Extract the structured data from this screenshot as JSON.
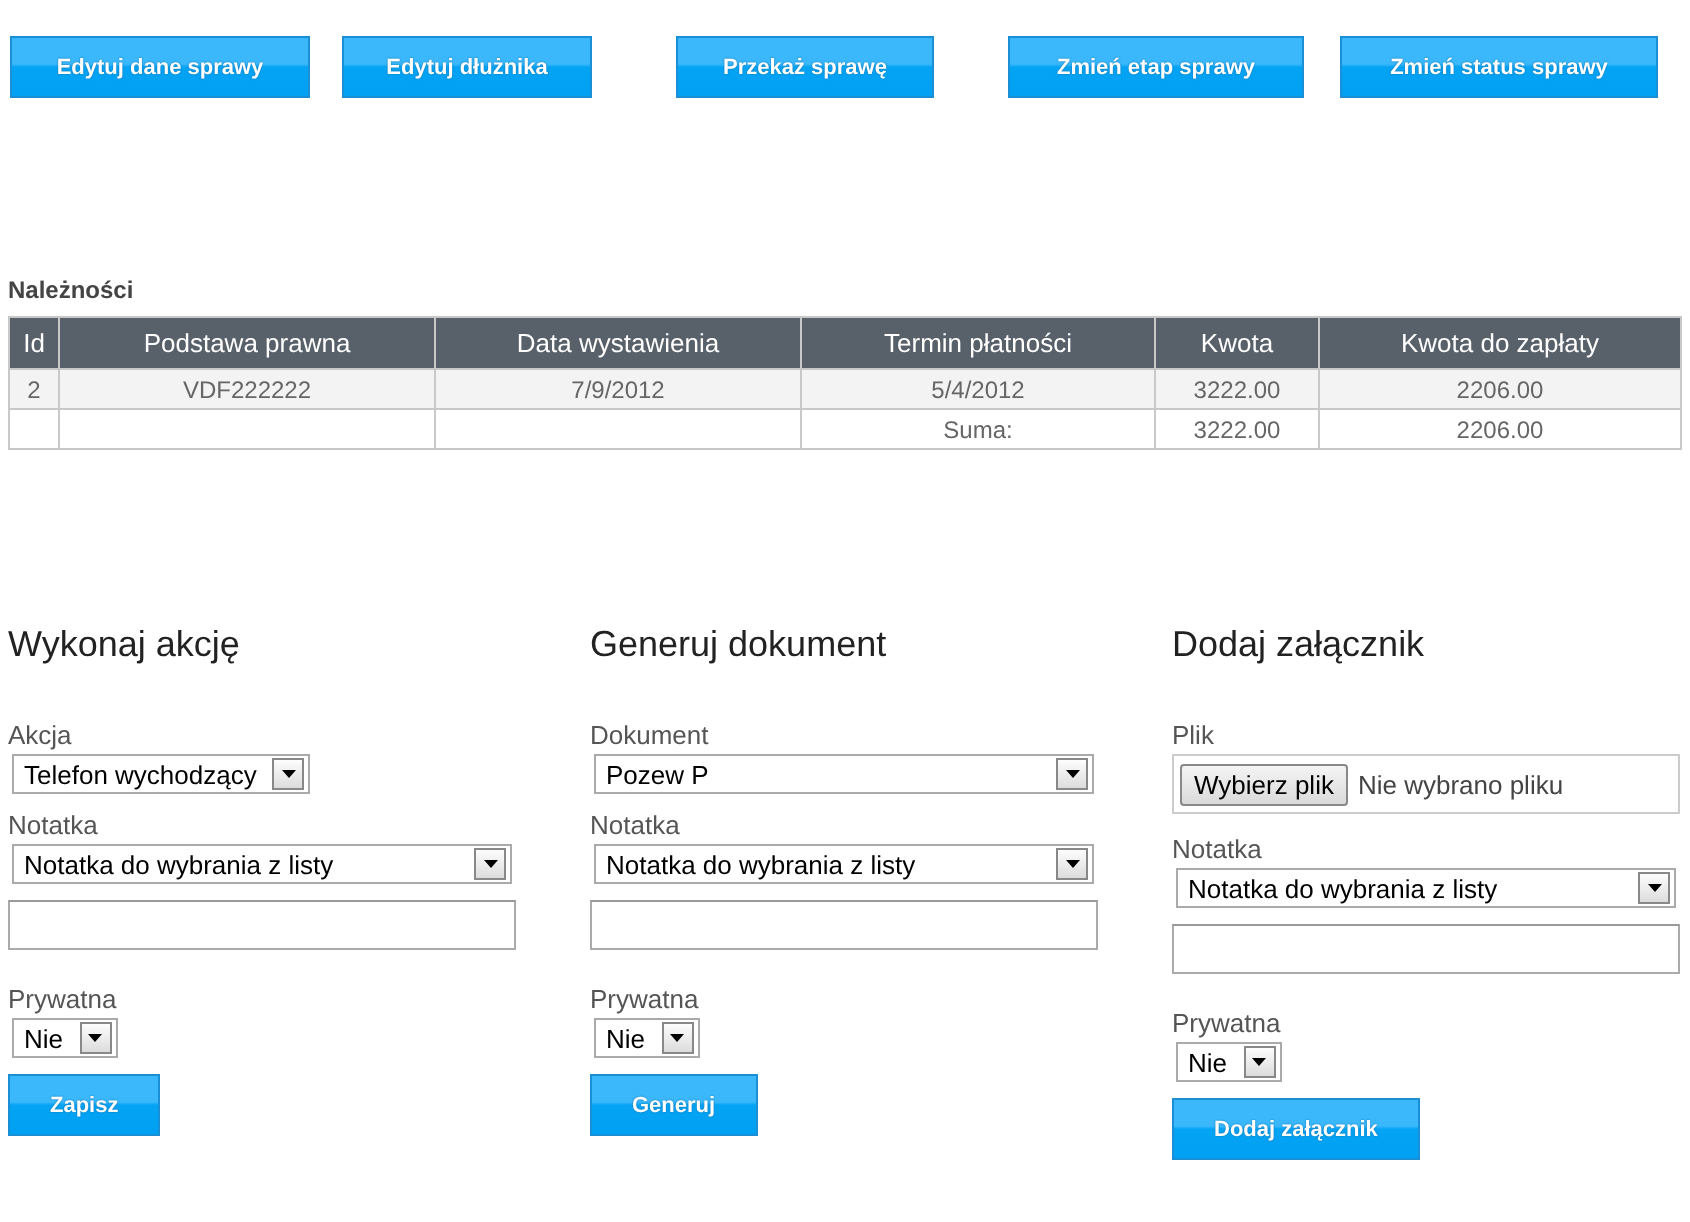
{
  "toolbar": [
    {
      "label": "Edytuj dane sprawy"
    },
    {
      "label": "Edytuj dłużnika"
    },
    {
      "label": "Przekaż sprawę"
    },
    {
      "label": "Zmień etap sprawy"
    },
    {
      "label": "Zmień status sprawy"
    }
  ],
  "receivables": {
    "title": "Należności",
    "columns": [
      "Id",
      "Podstawa prawna",
      "Data wystawienia",
      "Termin płatności",
      "Kwota",
      "Kwota do zapłaty"
    ],
    "rows": [
      [
        "2",
        "VDF222222",
        "7/9/2012",
        "5/4/2012",
        "3222.00",
        "2206.00"
      ],
      [
        "",
        "",
        "",
        "Suma:",
        "3222.00",
        "2206.00"
      ]
    ]
  },
  "panels": [
    {
      "title": "Wykonaj akcję",
      "fields": [
        {
          "kind": "dropdown",
          "label": "Akcja",
          "value": "Telefon wychodzący"
        },
        {
          "kind": "wide-dropdown",
          "label": "Notatka",
          "value": "Notatka do wybrania z listy"
        },
        {
          "kind": "text-input"
        },
        {
          "kind": "dropdown",
          "label": "Prywatna",
          "value": "Nie"
        }
      ],
      "button": "Zapisz"
    },
    {
      "title": "Generuj dokument",
      "fields": [
        {
          "kind": "wide-dropdown",
          "label": "Dokument",
          "value": "Pozew P"
        },
        {
          "kind": "wide-dropdown",
          "label": "Notatka",
          "value": "Notatka do wybrania z listy"
        },
        {
          "kind": "text-input"
        },
        {
          "kind": "dropdown",
          "label": "Prywatna",
          "value": "Nie"
        }
      ],
      "button": "Generuj"
    },
    {
      "title": "Dodaj załącznik",
      "fields": [
        {
          "kind": "file",
          "label": "Plik",
          "button": "Wybierz plik",
          "status": "Nie wybrano pliku"
        },
        {
          "kind": "wide-dropdown",
          "label": "Notatka",
          "value": "Notatka do wybrania z listy"
        },
        {
          "kind": "text-input"
        },
        {
          "kind": "dropdown",
          "label": "Prywatna",
          "value": "Nie"
        }
      ],
      "button": "Dodaj załącznik"
    }
  ]
}
